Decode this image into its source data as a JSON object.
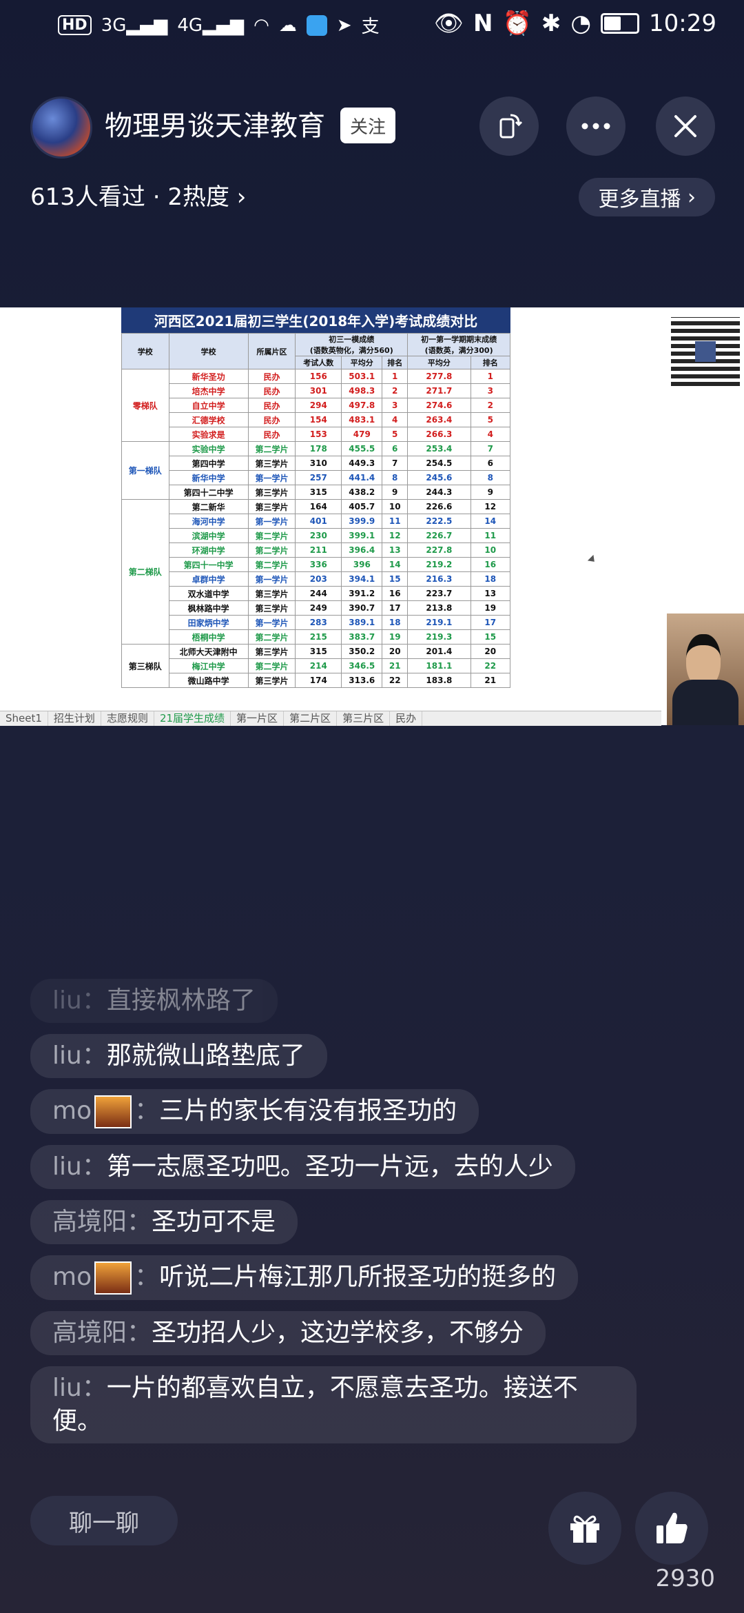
{
  "status_bar": {
    "hd_label": "HD",
    "net1": "3G",
    "net2": "4G",
    "time": "10:29",
    "battery_level": 0.55
  },
  "header": {
    "channel_name": "物理男谈天津教育",
    "follow_label": "关注",
    "viewers_text": "613人看过 · 2热度",
    "more_live_label": "更多直播"
  },
  "sheet": {
    "title": "河西区2021届初三学生(2018年入学)考试成绩对比",
    "headers": {
      "tier": "学校",
      "school": "学校",
      "district": "所属片区",
      "group1": "初三一模成绩",
      "group1_sub": "(语数英物化，满分560)",
      "group2": "初一第一学期期末成绩",
      "group2_sub": "(语数英，满分300)",
      "count": "考试人数",
      "avg1": "平均分",
      "rank1": "排名",
      "avg2": "平均分",
      "rank2": "排名"
    },
    "tiers": [
      {
        "name": "零梯队",
        "color": "#d21e1e",
        "rows": [
          {
            "school": "新华圣功",
            "district": "民办",
            "count": "156",
            "avg1": "503.1",
            "rank1": "1",
            "avg2": "277.8",
            "rank2": "1",
            "color": "#d21e1e"
          },
          {
            "school": "培杰中学",
            "district": "民办",
            "count": "301",
            "avg1": "498.3",
            "rank1": "2",
            "avg2": "271.7",
            "rank2": "3",
            "color": "#d21e1e"
          },
          {
            "school": "自立中学",
            "district": "民办",
            "count": "294",
            "avg1": "497.8",
            "rank1": "3",
            "avg2": "274.6",
            "rank2": "2",
            "color": "#d21e1e"
          },
          {
            "school": "汇德学校",
            "district": "民办",
            "count": "154",
            "avg1": "483.1",
            "rank1": "4",
            "avg2": "263.4",
            "rank2": "5",
            "color": "#d21e1e"
          },
          {
            "school": "实验求是",
            "district": "民办",
            "count": "153",
            "avg1": "479",
            "rank1": "5",
            "avg2": "266.3",
            "rank2": "4",
            "color": "#d21e1e"
          }
        ]
      },
      {
        "name": "第一梯队",
        "color": "#1e56b8",
        "rows": [
          {
            "school": "实验中学",
            "district": "第二学片",
            "count": "178",
            "avg1": "455.5",
            "rank1": "6",
            "avg2": "253.4",
            "rank2": "7",
            "color": "#1f9a4a"
          },
          {
            "school": "第四中学",
            "district": "第三学片",
            "count": "310",
            "avg1": "449.3",
            "rank1": "7",
            "avg2": "254.5",
            "rank2": "6",
            "color": "#111111"
          },
          {
            "school": "新华中学",
            "district": "第一学片",
            "count": "257",
            "avg1": "441.4",
            "rank1": "8",
            "avg2": "245.6",
            "rank2": "8",
            "color": "#1e56b8"
          },
          {
            "school": "第四十二中学",
            "district": "第三学片",
            "count": "315",
            "avg1": "438.2",
            "rank1": "9",
            "avg2": "244.3",
            "rank2": "9",
            "color": "#111111"
          }
        ]
      },
      {
        "name": "第二梯队",
        "color": "#1f9a4a",
        "rows": [
          {
            "school": "第二新华",
            "district": "第三学片",
            "count": "164",
            "avg1": "405.7",
            "rank1": "10",
            "avg2": "226.6",
            "rank2": "12",
            "color": "#111111"
          },
          {
            "school": "海河中学",
            "district": "第一学片",
            "count": "401",
            "avg1": "399.9",
            "rank1": "11",
            "avg2": "222.5",
            "rank2": "14",
            "color": "#1e56b8"
          },
          {
            "school": "滨湖中学",
            "district": "第二学片",
            "count": "230",
            "avg1": "399.1",
            "rank1": "12",
            "avg2": "226.7",
            "rank2": "11",
            "color": "#1f9a4a"
          },
          {
            "school": "环湖中学",
            "district": "第二学片",
            "count": "211",
            "avg1": "396.4",
            "rank1": "13",
            "avg2": "227.8",
            "rank2": "10",
            "color": "#1f9a4a"
          },
          {
            "school": "第四十一中学",
            "district": "第二学片",
            "count": "336",
            "avg1": "396",
            "rank1": "14",
            "avg2": "219.2",
            "rank2": "16",
            "color": "#1f9a4a"
          },
          {
            "school": "卓群中学",
            "district": "第一学片",
            "count": "203",
            "avg1": "394.1",
            "rank1": "15",
            "avg2": "216.3",
            "rank2": "18",
            "color": "#1e56b8"
          },
          {
            "school": "双水道中学",
            "district": "第三学片",
            "count": "244",
            "avg1": "391.2",
            "rank1": "16",
            "avg2": "223.7",
            "rank2": "13",
            "color": "#111111"
          },
          {
            "school": "枫林路中学",
            "district": "第三学片",
            "count": "249",
            "avg1": "390.7",
            "rank1": "17",
            "avg2": "213.8",
            "rank2": "19",
            "color": "#111111"
          },
          {
            "school": "田家炳中学",
            "district": "第一学片",
            "count": "283",
            "avg1": "389.1",
            "rank1": "18",
            "avg2": "219.1",
            "rank2": "17",
            "color": "#1e56b8"
          },
          {
            "school": "梧桐中学",
            "district": "第二学片",
            "count": "215",
            "avg1": "383.7",
            "rank1": "19",
            "avg2": "219.3",
            "rank2": "15",
            "color": "#1f9a4a"
          }
        ]
      },
      {
        "name": "第三梯队",
        "color": "#111111",
        "rows": [
          {
            "school": "北师大天津附中",
            "district": "第三学片",
            "count": "315",
            "avg1": "350.2",
            "rank1": "20",
            "avg2": "201.4",
            "rank2": "20",
            "color": "#111111"
          },
          {
            "school": "梅江中学",
            "district": "第二学片",
            "count": "214",
            "avg1": "346.5",
            "rank1": "21",
            "avg2": "181.1",
            "rank2": "22",
            "color": "#1f9a4a"
          },
          {
            "school": "微山路中学",
            "district": "第三学片",
            "count": "174",
            "avg1": "313.6",
            "rank1": "22",
            "avg2": "183.8",
            "rank2": "21",
            "color": "#111111"
          }
        ]
      }
    ],
    "tabs": [
      "Sheet1",
      "招生计划",
      "志愿规则",
      "21届学生成绩",
      "第一片区",
      "第二片区",
      "第三片区",
      "民办"
    ]
  },
  "chat": [
    {
      "user": "liu",
      "sep": "：",
      "text": "直接枫林路了",
      "badge": false,
      "faded": true
    },
    {
      "user": "liu",
      "sep": "：",
      "text": "那就微山路垫底了",
      "badge": false,
      "faded": false
    },
    {
      "user": "mo",
      "sep": "：",
      "text": "三片的家长有没有报圣功的",
      "badge": true,
      "faded": false
    },
    {
      "user": "liu",
      "sep": "：",
      "text": "第一志愿圣功吧。圣功一片远，去的人少",
      "badge": false,
      "faded": false
    },
    {
      "user": "高境阳",
      "sep": "：",
      "text": "圣功可不是",
      "badge": false,
      "faded": false
    },
    {
      "user": "mo",
      "sep": "：",
      "text": "听说二片梅江那几所报圣功的挺多的",
      "badge": true,
      "faded": false
    },
    {
      "user": "高境阳",
      "sep": "：",
      "text": "圣功招人少，这边学校多，不够分",
      "badge": false,
      "faded": false
    },
    {
      "user": "liu",
      "sep": "：",
      "text": "一片的都喜欢自立，不愿意去圣功。接送不便。",
      "badge": false,
      "faded": false
    }
  ],
  "bottom": {
    "chat_placeholder": "聊一聊",
    "likes": "2930"
  }
}
